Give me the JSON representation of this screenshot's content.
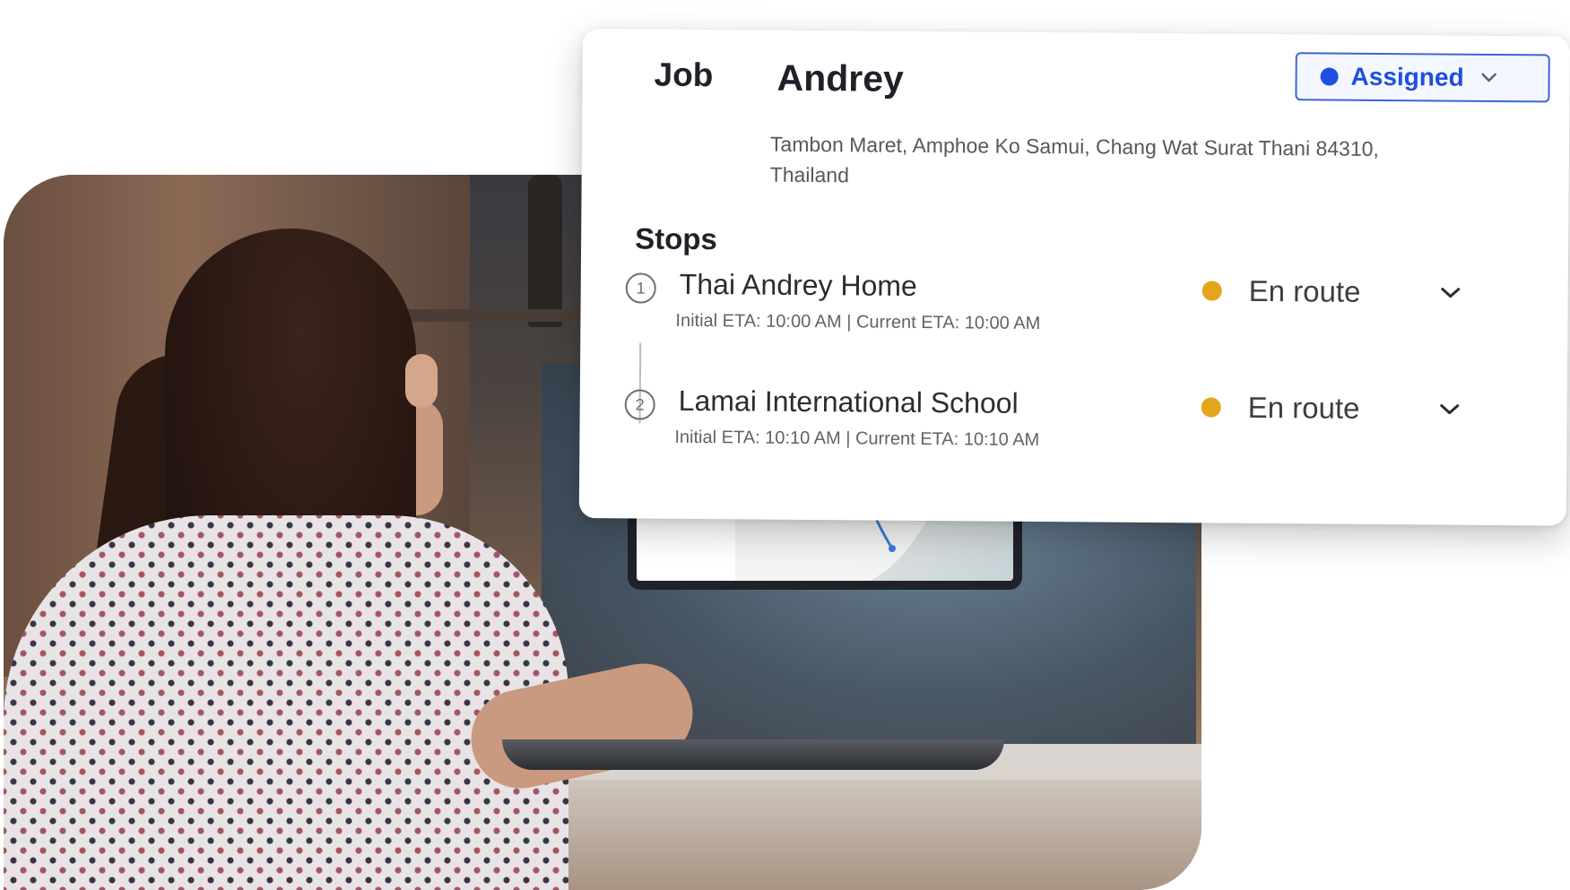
{
  "job": {
    "label": "Job",
    "name": "Andrey",
    "address": "Tambon Maret, Amphoe Ko Samui, Chang Wat Surat Thani 84310, Thailand",
    "status": {
      "label": "Assigned",
      "color": "#1f4fe0",
      "icon": "chevron-down-icon"
    }
  },
  "stops": {
    "title": "Stops",
    "items": [
      {
        "number": "1",
        "name": "Thai Andrey Home",
        "eta": "Initial ETA: 10:00 AM | Current ETA: 10:00 AM",
        "status": "En route",
        "status_color": "#e3a51b"
      },
      {
        "number": "2",
        "name": "Lamai International School",
        "eta": "Initial ETA: 10:10 AM | Current ETA: 10:10 AM",
        "status": "En route",
        "status_color": "#e3a51b"
      }
    ]
  },
  "colors": {
    "accent": "#3e63d9",
    "en_route": "#e3a51b"
  }
}
